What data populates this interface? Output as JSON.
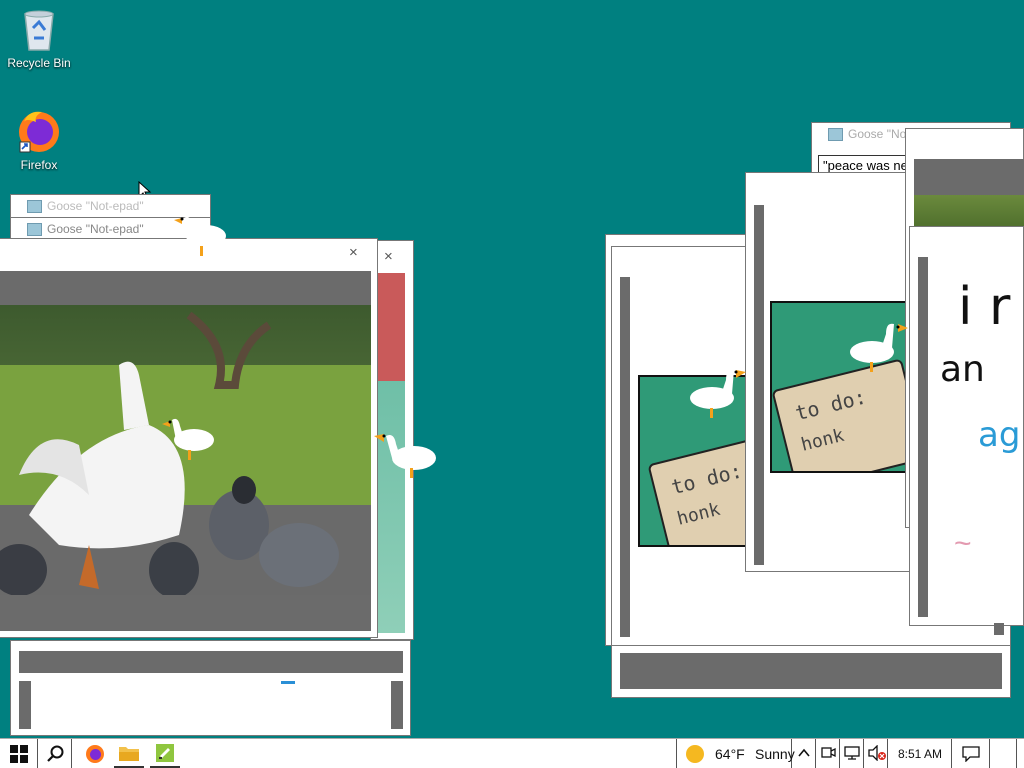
{
  "desktop": {
    "icons": [
      {
        "label": "Recycle Bin",
        "icon": "recycle-bin-icon"
      },
      {
        "label": "Firefox",
        "icon": "firefox-icon"
      }
    ]
  },
  "windows": {
    "notepad_title": "Goose \"Not-epad\"",
    "notepad_title_back": "Goose \"Not-epad\"",
    "notepad_title_right": "Goose \"No",
    "notepad_text_right": "\"peace was ne",
    "close_glyph": "×"
  },
  "memes": {
    "note_line1": "to do:",
    "note_line2": "honk"
  },
  "drawing": {
    "line1": "i r",
    "line2": "an",
    "line3": "ag",
    "line4": "~"
  },
  "taskbar": {
    "weather_temp": "64°F",
    "weather_condition": "Sunny",
    "time": "8:51 AM"
  },
  "colors": {
    "desktop": "#008080",
    "meme_green": "#2f9a77",
    "note_beige": "#e0cfb0"
  }
}
